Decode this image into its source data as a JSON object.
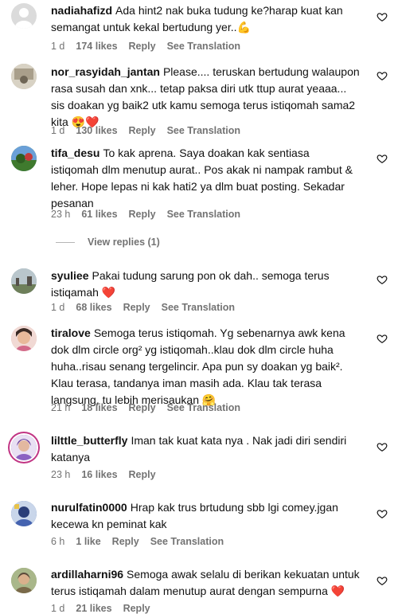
{
  "comments": [
    {
      "username": "nadiahafizd",
      "text": "Ada hint2 nak buka tudung ke?harap kuat kan semangat untuk kekal bertudung yer..💪",
      "time": "1 d",
      "likes": "174 likes",
      "reply_label": "Reply",
      "translation_label": "See Translation"
    },
    {
      "username": "nor_rasyidah_jantan",
      "text": "Please.... teruskan bertudung walaupon rasa susah dan xnk... tetap paksa diri utk ttup aurat yeaaa... sis doakan yg baik2 utk kamu semoga terus istiqomah sama2 kita 😍❤️",
      "time": "1 d",
      "likes": "130 likes",
      "reply_label": "Reply",
      "translation_label": "See Translation"
    },
    {
      "username": "tifa_desu",
      "text": "To kak aprena. Saya doakan kak sentiasa istiqomah dlm menutup aurat.. Pos akak ni nampak rambut & leher. Hope lepas ni kak hati2 ya dlm buat posting. Sekadar pesanan",
      "time": "23 h",
      "likes": "61 likes",
      "reply_label": "Reply",
      "translation_label": "See Translation",
      "view_replies": "View replies (1)"
    },
    {
      "username": "syuliee",
      "text": "Pakai tudung sarung pon ok dah.. semoga terus istiqamah ❤️",
      "time": "1 d",
      "likes": "68 likes",
      "reply_label": "Reply",
      "translation_label": "See Translation"
    },
    {
      "username": "tiralove",
      "text": "Semoga terus istiqomah. Yg sebenarnya awk kena dok dlm circle org² yg istiqomah..klau dok dlm circle huha huha..risau senang tergelincir. Apa pun sy doakan yg baik². Klau terasa, tandanya iman masih ada. Klau tak terasa langsung, tu lebih merisaukan 🤗",
      "time": "21 h",
      "likes": "18 likes",
      "reply_label": "Reply",
      "translation_label": "See Translation"
    },
    {
      "username": "lilttle_butterfly",
      "text": "Iman tak kuat kata nya . Nak jadi diri sendiri katanya",
      "time": "23 h",
      "likes": "16 likes",
      "reply_label": "Reply",
      "translation_label": ""
    },
    {
      "username": "nurulfatin0000",
      "text": "Hrap kak trus brtudung sbb lgi comey.jgan kecewa kn peminat kak",
      "time": "6 h",
      "likes": "1 like",
      "reply_label": "Reply",
      "translation_label": "See Translation"
    },
    {
      "username": "ardillaharni96",
      "text": "Semoga awak selalu di berikan kekuatan untuk terus istiqamah dalam menutup aurat dengan sempurna ❤️",
      "time": "1 d",
      "likes": "21 likes",
      "reply_label": "Reply",
      "translation_label": ""
    }
  ],
  "icons": {
    "like": "heart-outline-icon",
    "avatar_colors": [
      "#d9d9d9",
      "#c8bfae",
      "#4f8a3a",
      "#8aa0a8",
      "#d9a6a0",
      "#7a5fa8",
      "#3b5ca8",
      "#8a9a6a"
    ]
  }
}
